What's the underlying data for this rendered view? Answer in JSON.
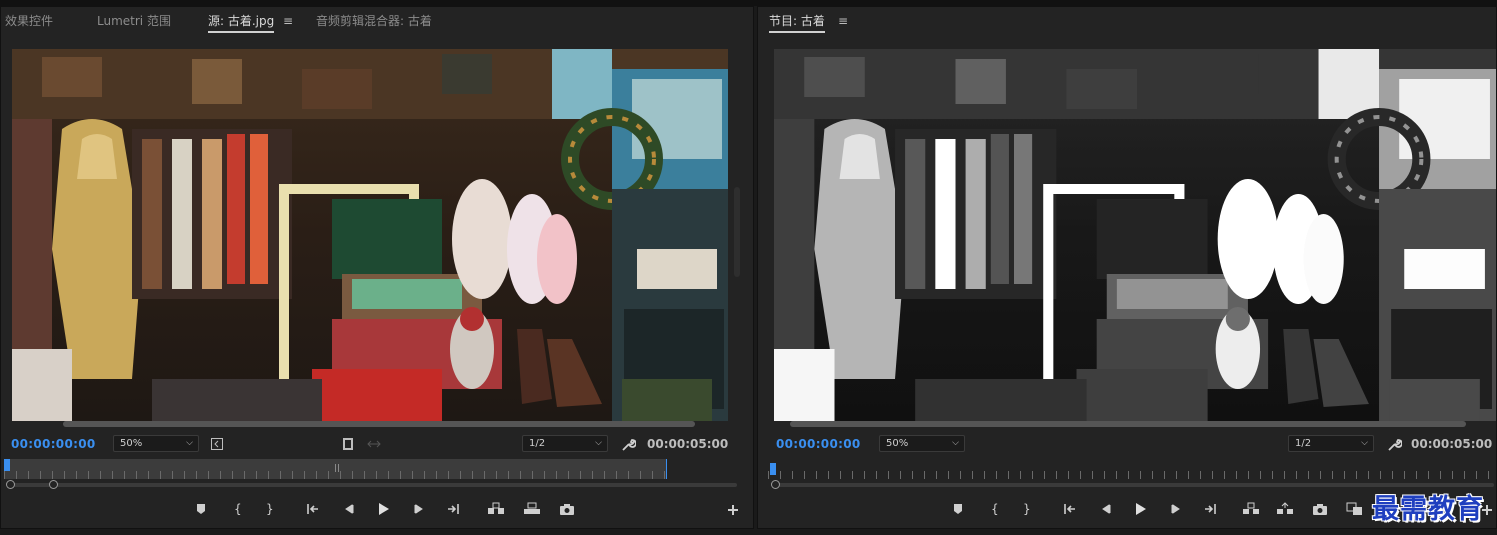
{
  "source_panel": {
    "tabs": [
      {
        "label": "效果控件",
        "active": false
      },
      {
        "label": "Lumetri 范围",
        "active": false
      },
      {
        "label": "源: 古着.jpg",
        "active": true
      },
      {
        "label": "音频剪辑混合器: 古着",
        "active": false
      }
    ],
    "menu_glyph": "≡",
    "timecode": "00:00:00:00",
    "zoom": "50%",
    "resolution": "1/2",
    "duration": "00:00:05:00"
  },
  "program_panel": {
    "title": "节目: 古着",
    "menu_glyph": "≡",
    "timecode": "00:00:00:00",
    "zoom": "50%",
    "resolution": "1/2",
    "duration": "00:00:05:00"
  },
  "watermark": "最需教育",
  "colors": {
    "accent_blue": "#3a8ff0",
    "panel_bg": "#232323",
    "timeline_bg": "#3c3c3c"
  }
}
